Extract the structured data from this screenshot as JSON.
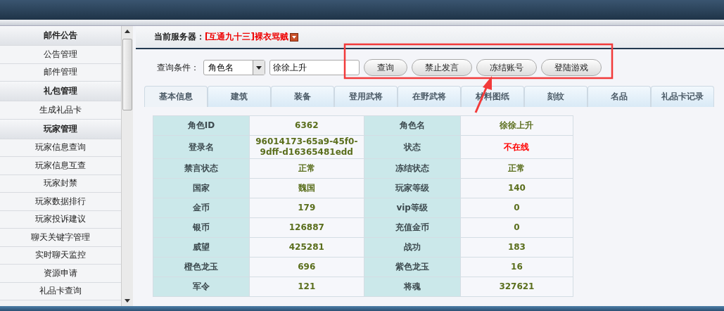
{
  "sidebar": {
    "items": [
      {
        "kind": "header",
        "label": "邮件公告",
        "selected": false
      },
      {
        "kind": "item",
        "label": "公告管理",
        "selected": false
      },
      {
        "kind": "item",
        "label": "邮件管理",
        "selected": false
      },
      {
        "kind": "header",
        "label": "礼包管理",
        "selected": false
      },
      {
        "kind": "item",
        "label": "生成礼品卡",
        "selected": false
      },
      {
        "kind": "header",
        "label": "玩家管理",
        "selected": false
      },
      {
        "kind": "item",
        "label": "玩家信息查询",
        "selected": false
      },
      {
        "kind": "item",
        "label": "玩家信息互查",
        "selected": false
      },
      {
        "kind": "item",
        "label": "玩家封禁",
        "selected": false
      },
      {
        "kind": "item",
        "label": "玩家数据排行",
        "selected": false
      },
      {
        "kind": "item",
        "label": "玩家投诉建议",
        "selected": false
      },
      {
        "kind": "item",
        "label": "聊天关键字管理",
        "selected": false
      },
      {
        "kind": "item",
        "label": "实时聊天监控",
        "selected": false
      },
      {
        "kind": "item",
        "label": "资源申请",
        "selected": false
      },
      {
        "kind": "item",
        "label": "礼品卡查询",
        "selected": false
      }
    ]
  },
  "server": {
    "label": "当前服务器：",
    "value": "[互通九十三]裸衣骂贼"
  },
  "query": {
    "label": "查询条件：",
    "select_value": "角色名",
    "input_value": "徐徐上升",
    "buttons": [
      "查询",
      "禁止发言",
      "冻结账号",
      "登陆游戏"
    ]
  },
  "tabs": [
    {
      "label": "基本信息",
      "selected": true
    },
    {
      "label": "建筑",
      "selected": false
    },
    {
      "label": "装备",
      "selected": false
    },
    {
      "label": "登用武将",
      "selected": false
    },
    {
      "label": "在野武将",
      "selected": false
    },
    {
      "label": "材料图纸",
      "selected": false
    },
    {
      "label": "刻纹",
      "selected": false
    },
    {
      "label": "名品",
      "selected": false
    },
    {
      "label": "礼品卡记录",
      "selected": false
    }
  ],
  "table": {
    "rows": [
      [
        {
          "label": "角色ID",
          "value": "6362",
          "alert": false
        },
        {
          "label": "角色名",
          "value": "徐徐上升",
          "alert": false
        }
      ],
      [
        {
          "label": "登录名",
          "value": "96014173-65a9-45f0-9dff-d16365481edd",
          "alert": false
        },
        {
          "label": "状态",
          "value": "不在线",
          "alert": true
        }
      ],
      [
        {
          "label": "禁言状态",
          "value": "正常",
          "alert": false
        },
        {
          "label": "冻结状态",
          "value": "正常",
          "alert": false
        }
      ],
      [
        {
          "label": "国家",
          "value": "魏国",
          "alert": false
        },
        {
          "label": "玩家等级",
          "value": "140",
          "alert": false
        }
      ],
      [
        {
          "label": "金币",
          "value": "179",
          "alert": false
        },
        {
          "label": "vip等级",
          "value": "0",
          "alert": false
        }
      ],
      [
        {
          "label": "银币",
          "value": "126887",
          "alert": false
        },
        {
          "label": "充值金币",
          "value": "0",
          "alert": false
        }
      ],
      [
        {
          "label": "威望",
          "value": "425281",
          "alert": false
        },
        {
          "label": "战功",
          "value": "183",
          "alert": false
        }
      ],
      [
        {
          "label": "橙色龙玉",
          "value": "696",
          "alert": false
        },
        {
          "label": "紫色龙玉",
          "value": "16",
          "alert": false
        }
      ],
      [
        {
          "label": "军令",
          "value": "121",
          "alert": false
        },
        {
          "label": "将魂",
          "value": "327621",
          "alert": false
        }
      ]
    ]
  }
}
